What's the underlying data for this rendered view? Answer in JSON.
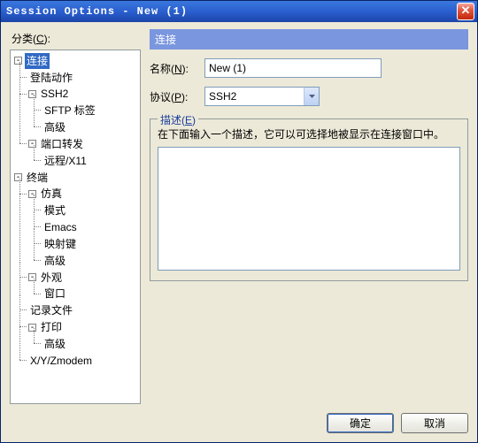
{
  "window": {
    "title": "Session Options - New (1)"
  },
  "category": {
    "label_prefix": "分类(",
    "label_key": "C",
    "label_suffix": "):"
  },
  "tree": {
    "connect": "连接",
    "login_action": "登陆动作",
    "ssh2": "SSH2",
    "sftp_tab": "SFTP 标签",
    "advanced": "高级",
    "port_forward": "端口转发",
    "remote_x11": "远程/X11",
    "terminal": "终端",
    "emulation": "仿真",
    "mode": "模式",
    "emacs": "Emacs",
    "mapkeys": "映射键",
    "advanced2": "高级",
    "appearance": "外观",
    "window": "窗口",
    "log_file": "记录文件",
    "print": "打印",
    "advanced3": "高级",
    "xyz": "X/Y/Zmodem"
  },
  "section": {
    "header": "连接",
    "name_pre": "名称(",
    "name_key": "N",
    "name_suf": "):",
    "name_value": "New (1)",
    "proto_pre": "协议(",
    "proto_key": "P",
    "proto_suf": "):",
    "proto_value": "SSH2",
    "desc_pre": "描述(",
    "desc_key": "E",
    "desc_suf": ")",
    "desc_hint": "在下面输入一个描述，它可以可选择地被显示在连接窗口中。"
  },
  "buttons": {
    "ok": "确定",
    "cancel": "取消"
  }
}
